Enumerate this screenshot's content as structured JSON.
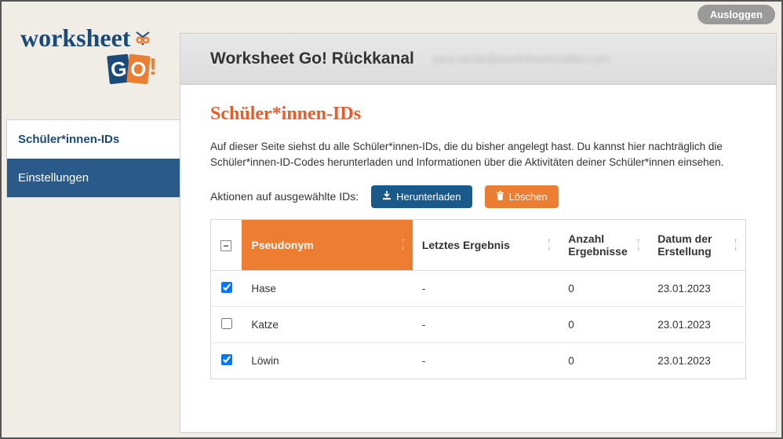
{
  "logout_label": "Ausloggen",
  "logo": {
    "word": "worksheet",
    "go_g": "G",
    "go_o": "O",
    "go_excl": "!"
  },
  "sidebar": {
    "items": [
      {
        "label": "Schüler*innen-IDs",
        "active": true
      },
      {
        "label": "Einstellungen",
        "active": false
      }
    ]
  },
  "header": {
    "title": "Worksheet Go! Rückkanal",
    "email": "jana.wode@worksheetcrafter.com"
  },
  "page": {
    "title": "Schüler*innen-IDs",
    "description": "Auf dieser Seite siehst du alle Schüler*innen-IDs, die du bisher angelegt hast. Du kannst hier nachträglich die Schüler*innen-ID-Codes herunterladen und Informationen über die Aktivitäten deiner Schüler*innen einsehen.",
    "actions_label": "Aktionen auf ausgewählte IDs:",
    "download_label": "Herunterladen",
    "delete_label": "Löschen"
  },
  "table": {
    "columns": {
      "pseudonym": "Pseudonym",
      "last_result": "Letztes Ergebnis",
      "result_count": "Anzahl Ergebnisse",
      "created": "Datum der Erstellung"
    },
    "rows": [
      {
        "checked": true,
        "pseudonym": "Hase",
        "last_result": "-",
        "result_count": "0",
        "created": "23.01.2023"
      },
      {
        "checked": false,
        "pseudonym": "Katze",
        "last_result": "-",
        "result_count": "0",
        "created": "23.01.2023"
      },
      {
        "checked": true,
        "pseudonym": "Löwin",
        "last_result": "-",
        "result_count": "0",
        "created": "23.01.2023"
      }
    ]
  }
}
